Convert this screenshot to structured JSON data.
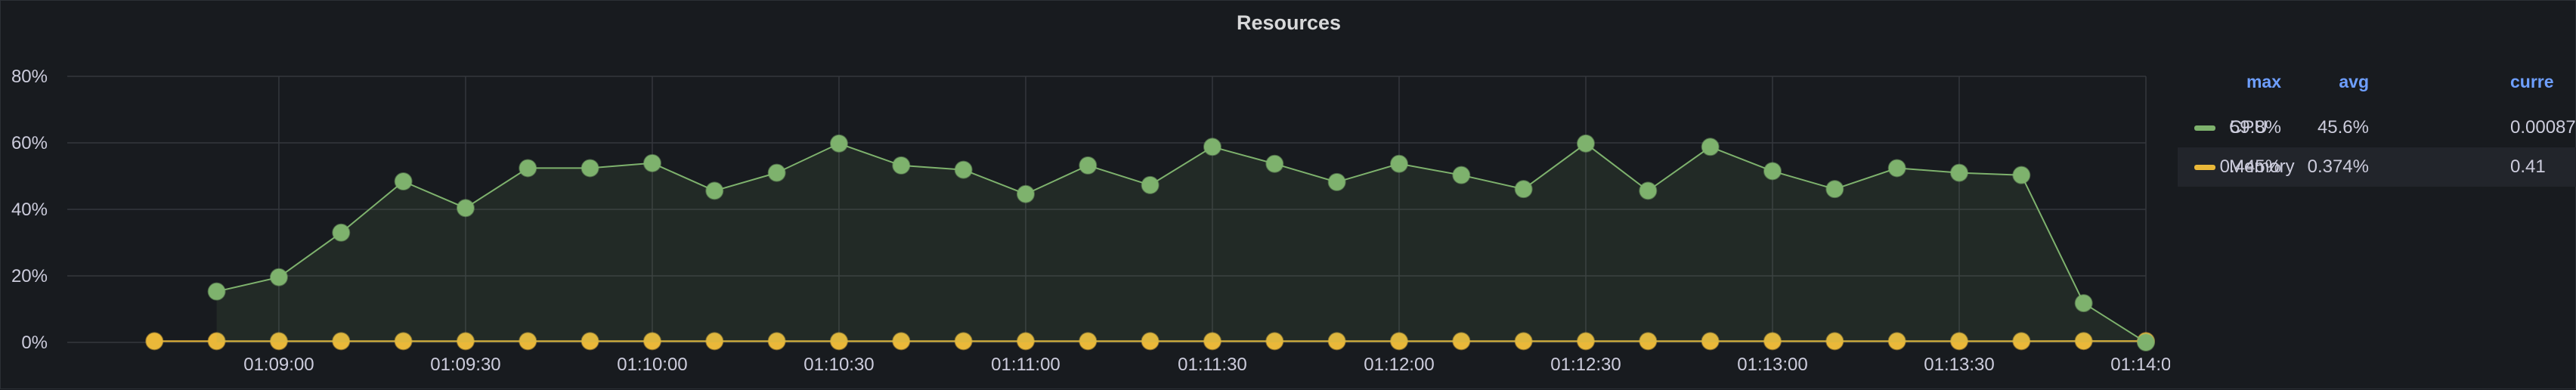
{
  "panel": {
    "title": "Resources"
  },
  "legend": {
    "headers": {
      "max": "max",
      "avg": "avg",
      "current": "curre"
    },
    "rows": [
      {
        "name": "CPU",
        "color": "#7eb26d",
        "max": "59.8%",
        "avg": "45.6%",
        "current": "0.00087"
      },
      {
        "name": "Memory",
        "color": "#eab839",
        "max": "0.445%",
        "avg": "0.374%",
        "current": "0.41"
      }
    ]
  },
  "chart_data": {
    "type": "line",
    "title": "Resources",
    "xlabel": "",
    "ylabel": "",
    "x_ticks": [
      "01:09:00",
      "01:09:30",
      "01:10:00",
      "01:10:30",
      "01:11:00",
      "01:11:30",
      "01:12:00",
      "01:12:30",
      "01:13:00",
      "01:13:30",
      "01:14:00"
    ],
    "y_ticks": [
      "0%",
      "20%",
      "40%",
      "60%",
      "80%"
    ],
    "ylim": [
      0,
      80
    ],
    "grid": true,
    "legend_position": "right",
    "x": [
      "01:08:40",
      "01:08:50",
      "01:09:00",
      "01:09:10",
      "01:09:20",
      "01:09:30",
      "01:09:40",
      "01:09:50",
      "01:10:00",
      "01:10:10",
      "01:10:20",
      "01:10:30",
      "01:10:40",
      "01:10:50",
      "01:11:00",
      "01:11:10",
      "01:11:20",
      "01:11:30",
      "01:11:40",
      "01:11:50",
      "01:12:00",
      "01:12:10",
      "01:12:20",
      "01:12:30",
      "01:12:40",
      "01:12:50",
      "01:13:00",
      "01:13:10",
      "01:13:20",
      "01:13:30",
      "01:13:40",
      "01:13:50",
      "01:14:00"
    ],
    "series": [
      {
        "name": "CPU",
        "color": "#7eb26d",
        "values": [
          null,
          15.3,
          19.6,
          33.0,
          48.4,
          40.4,
          52.4,
          52.4,
          53.9,
          45.6,
          51.0,
          59.8,
          53.2,
          51.9,
          44.6,
          53.2,
          47.3,
          58.8,
          53.7,
          48.2,
          53.7,
          50.3,
          46.1,
          59.8,
          45.6,
          58.8,
          51.5,
          46.1,
          52.4,
          51.0,
          50.3,
          11.8,
          0.0
        ]
      },
      {
        "name": "Memory",
        "color": "#eab839",
        "values": [
          0.374,
          0.37,
          0.37,
          0.37,
          0.37,
          0.37,
          0.37,
          0.37,
          0.37,
          0.37,
          0.37,
          0.37,
          0.37,
          0.37,
          0.37,
          0.37,
          0.37,
          0.37,
          0.37,
          0.37,
          0.37,
          0.37,
          0.37,
          0.37,
          0.37,
          0.37,
          0.37,
          0.37,
          0.37,
          0.37,
          0.37,
          0.41,
          0.41
        ]
      }
    ]
  }
}
